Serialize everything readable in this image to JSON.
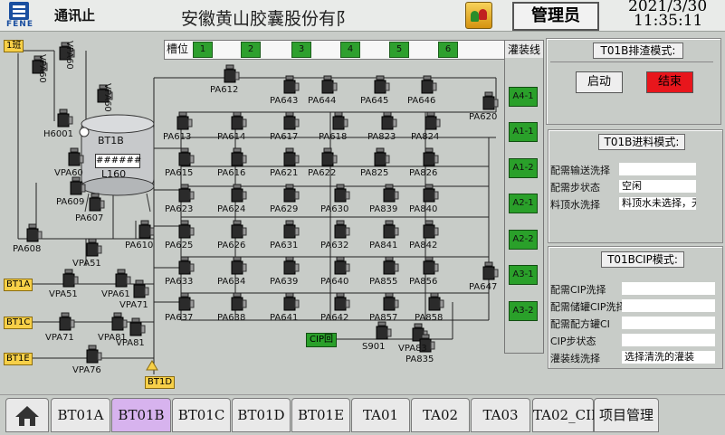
{
  "header": {
    "comm_label": "通讯止",
    "company": "安徽黄山胶囊股份有阝",
    "logo_text": "FENE",
    "user_role": "管理员",
    "date": "2021/3/30",
    "time": "11:35:11"
  },
  "tanks": {
    "label": "槽位",
    "slots": [
      "1",
      "2",
      "3",
      "4",
      "5",
      "6"
    ],
    "fill_header": "灌装线",
    "fill_buttons": [
      "A4-1",
      "A1-1",
      "A1-2",
      "A2-1",
      "A2-2",
      "A3-1",
      "A3-2"
    ]
  },
  "tank_main": {
    "name": "BT1B",
    "level_value": "######",
    "level_label": "L160"
  },
  "tags": {
    "in_1": "1班",
    "bt1a": "BT1A",
    "bt1c": "BT1C",
    "bt1e": "BT1E",
    "bt1d": "BT1D",
    "cip": "CIP回"
  },
  "valves": [
    "VPA60",
    "VPA60",
    "VPA60",
    "H6001",
    "VPA60",
    "PA609",
    "PA607",
    "PA608",
    "PA610",
    "VPA51",
    "VPA51",
    "VPA61",
    "VPA71",
    "VPA71",
    "VPA81",
    "VPA81",
    "VPA76",
    "PA612",
    "PA643",
    "PA644",
    "PA645",
    "PA646",
    "PA620",
    "PA613",
    "PA614",
    "PA617",
    "PA618",
    "PA823",
    "PA824",
    "PA615",
    "PA616",
    "PA621",
    "PA622",
    "PA825",
    "PA826",
    "PA623",
    "PA624",
    "PA629",
    "PA630",
    "PA839",
    "PA840",
    "PA625",
    "PA626",
    "PA631",
    "PA632",
    "PA841",
    "PA842",
    "PA633",
    "PA634",
    "PA639",
    "PA640",
    "PA855",
    "PA856",
    "PA647",
    "PA637",
    "PA638",
    "PA641",
    "PA642",
    "PA857",
    "PA858",
    "S901",
    "VPA83",
    "PA835"
  ],
  "panel_discharge": {
    "title": "T01B排渣模式:",
    "start": "启动",
    "end": "结束",
    "end_color": "#e8161c"
  },
  "panel_feed": {
    "title": "T01B进料模式:",
    "rows": [
      {
        "label": "配需输送洗择",
        "value": ""
      },
      {
        "label": "配需步状态",
        "value": "空闲"
      },
      {
        "label": "料顶水洗择",
        "value": "料顶水未选择，无效"
      }
    ]
  },
  "panel_cip": {
    "title": "T01BCIP模式:",
    "rows": [
      {
        "label": "配需CIP洗择",
        "value": ""
      },
      {
        "label": "配需储罐CIP洗择",
        "value": ""
      },
      {
        "label": "配需配方罐CI",
        "value": ""
      },
      {
        "label": "CIP步状态",
        "value": ""
      },
      {
        "label": "灌装线洗择",
        "value": "选择清洗的灌装"
      }
    ]
  },
  "tabs": [
    "BT01A",
    "BT01B",
    "BT01C",
    "BT01D",
    "BT01E",
    "TA01",
    "TA02",
    "TA03",
    "TA02_CIP",
    "项目管理"
  ],
  "active_tab": "BT01B",
  "colors": {
    "active_tab": "#d7b3ee",
    "green": "#2aa02a",
    "tag": "#f7d048"
  }
}
